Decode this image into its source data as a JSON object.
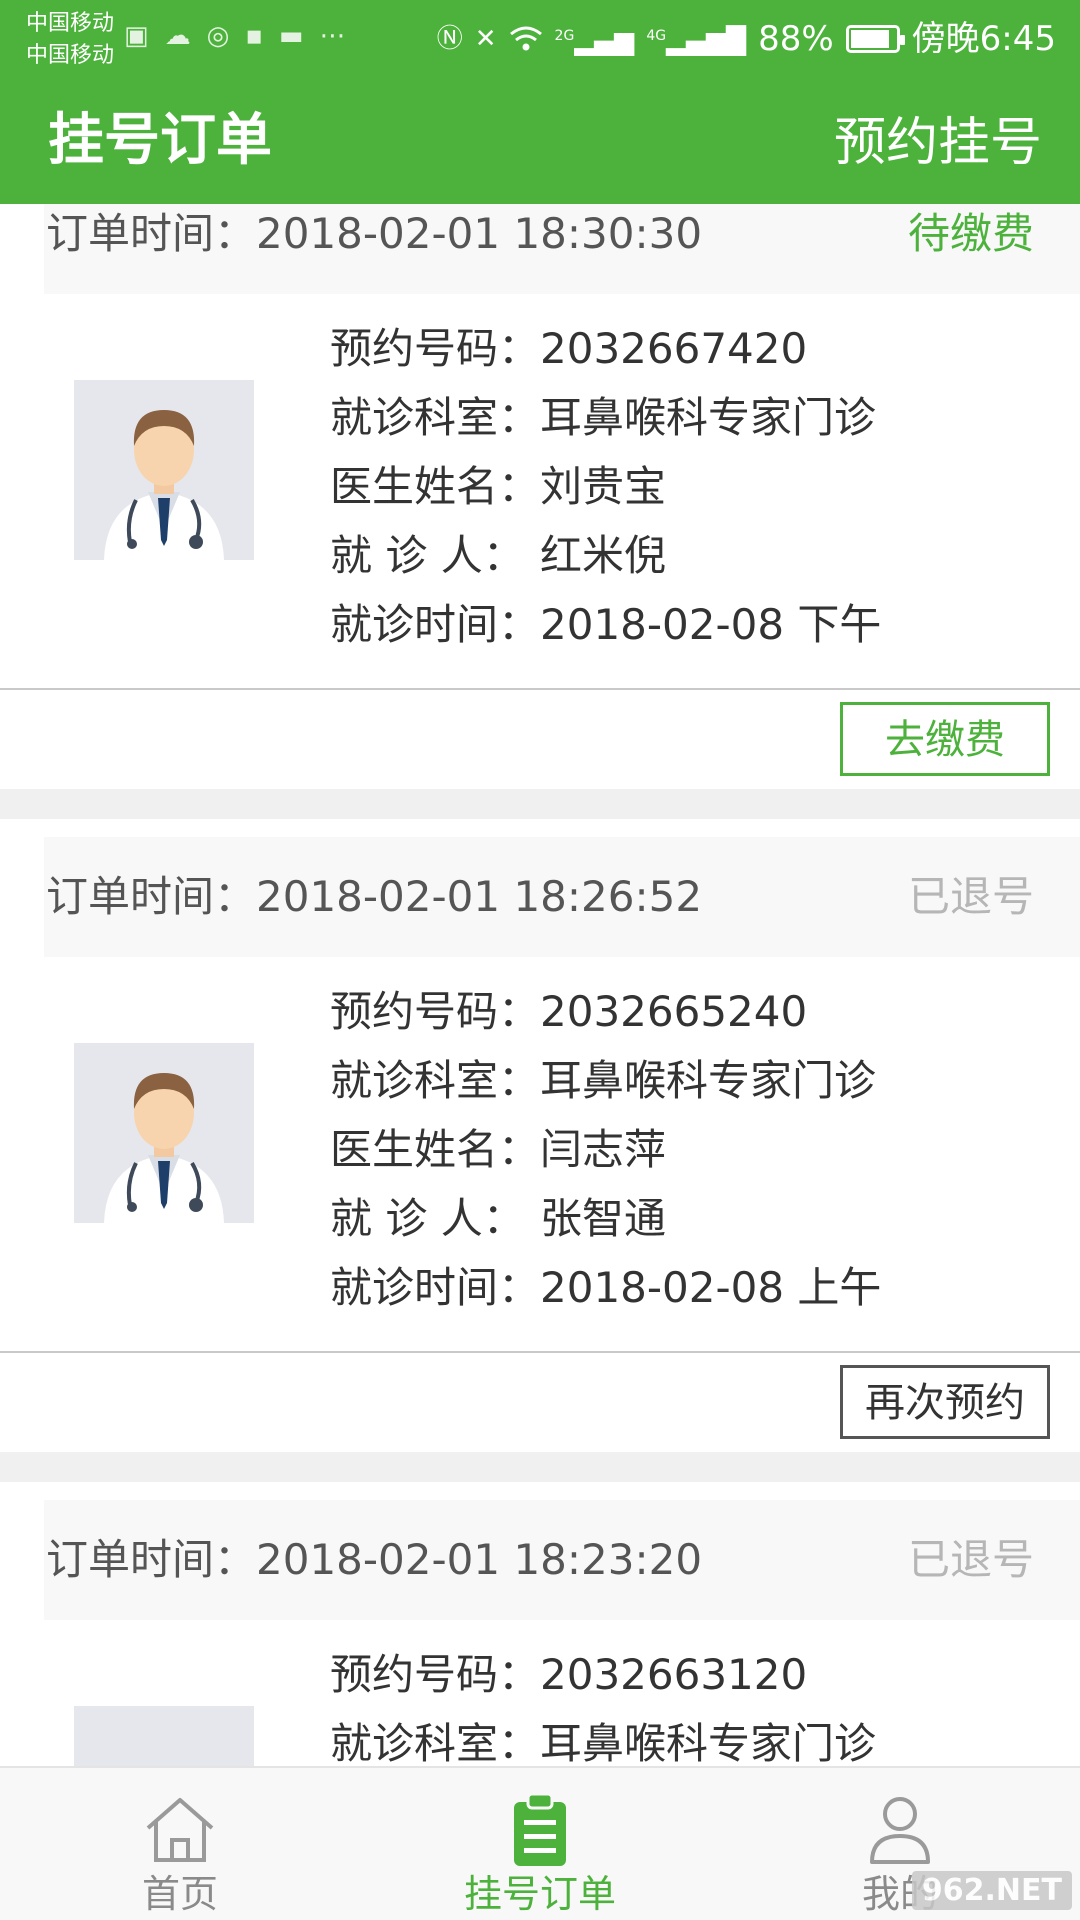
{
  "status_bar": {
    "carrier_1": "中国移动",
    "carrier_2": "中国移动",
    "network_2g": "2G",
    "network_4g": "4G",
    "battery_percent": "88%",
    "battery_level": 0.88,
    "time": "傍晚6:45",
    "icons": [
      "briefcase-icon",
      "cloud-icon",
      "netease-music-icon",
      "youku-icon",
      "android-icon",
      "more-dots-icon",
      "nfc-icon",
      "mute-icon",
      "wifi-icon",
      "signal-icon",
      "battery-icon"
    ]
  },
  "header": {
    "title": "挂号订单",
    "action": "预约挂号"
  },
  "labels": {
    "order_time": "订单时间：",
    "booking_no": "预约号码：",
    "department": "就诊科室：",
    "doctor": "医生姓名：",
    "patient": "就 诊 人：",
    "visit_time": "就诊时间："
  },
  "orders": [
    {
      "order_time": "2018-02-01 18:30:30",
      "status": "待缴费",
      "booking_no": "2032667420",
      "department": "耳鼻喉科专家门诊",
      "doctor": "刘贵宝",
      "patient": "红米倪",
      "visit_time": "2018-02-08  下午",
      "action": "去缴费"
    },
    {
      "order_time": "2018-02-01 18:26:52",
      "status": "已退号",
      "booking_no": "2032665240",
      "department": "耳鼻喉科专家门诊",
      "doctor": "闫志萍",
      "patient": "张智通",
      "visit_time": "2018-02-08  上午",
      "action": "再次预约"
    },
    {
      "order_time": "2018-02-01 18:23:20",
      "status": "已退号",
      "booking_no": "2032663120",
      "department": "耳鼻喉科专家门诊"
    }
  ],
  "bottom_nav": [
    {
      "label": "首页",
      "icon": "home-icon",
      "active": false
    },
    {
      "label": "挂号订单",
      "icon": "clipboard-icon",
      "active": true
    },
    {
      "label": "我的",
      "icon": "user-icon",
      "active": false
    }
  ],
  "watermark": "962.NET",
  "colors": {
    "brand_green": "#4cb23b",
    "status_gray": "#b6b6b6"
  }
}
